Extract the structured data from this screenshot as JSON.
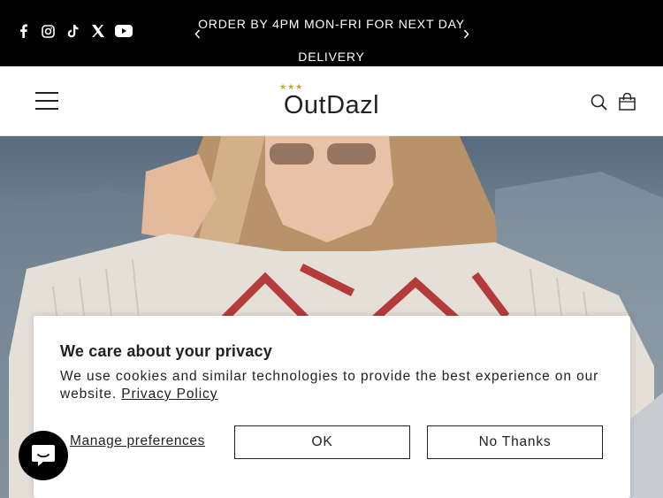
{
  "announcement": {
    "text": "ORDER BY 4PM MON-FRI FOR NEXT DAY DELIVERY",
    "prev_icon": "chevron-left-icon",
    "next_icon": "chevron-right-icon"
  },
  "socials": [
    "facebook-icon",
    "instagram-icon",
    "tiktok-icon",
    "x-icon",
    "youtube-icon"
  ],
  "header": {
    "logo_text": "OutDazl",
    "logo_stars": "★★★",
    "menu_icon": "hamburger-menu-icon",
    "search_icon": "search-icon",
    "cart_icon": "shopping-bag-icon"
  },
  "cookie_banner": {
    "title": "We care about your privacy",
    "body": "We use cookies and similar technologies to provide the best experience on our website. ",
    "policy_link": "Privacy Policy",
    "manage_label": "Manage preferences",
    "ok_label": "OK",
    "decline_label": "No Thanks"
  },
  "chat": {
    "icon": "chat-bubble-icon"
  },
  "colors": {
    "bar_bg": "#000000",
    "text": "#222222",
    "star_gold": "#c9a227"
  }
}
